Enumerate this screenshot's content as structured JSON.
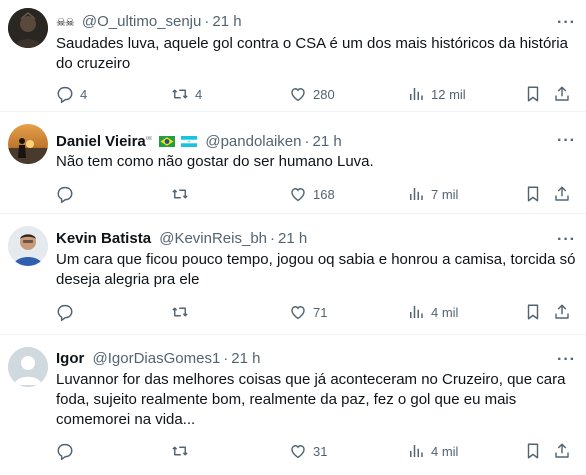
{
  "tweets": [
    {
      "name": "",
      "name_prefix": "☠☠",
      "handle": "@O_ultimo_senju",
      "time": "21 h",
      "text": "Saudades luva, aquele gol contra o CSA é um dos mais históricos da história do cruzeiro",
      "replies": "4",
      "retweets": "4",
      "likes": "280",
      "views": "12 mil"
    },
    {
      "name": "Daniel Vieira",
      "name_suffix": "ᶜᵉᶜ",
      "handle": "@pandolaiken",
      "time": "21 h",
      "text": "Não tem como não gostar do ser humano Luva.",
      "replies": "",
      "retweets": "",
      "likes": "168",
      "views": "7 mil"
    },
    {
      "name": "Kevin Batista",
      "handle": "@KevinReis_bh",
      "time": "21 h",
      "text": "Um cara que ficou pouco tempo, jogou oq sabia e honrou a camisa, torcida só deseja alegria pra ele",
      "replies": "",
      "retweets": "",
      "likes": "71",
      "views": "4 mil"
    },
    {
      "name": "Igor",
      "handle": "@IgorDiasGomes1",
      "time": "21 h",
      "text": "Luvannor for das melhores coisas que já aconteceram no Cruzeiro, que cara foda, sujeito realmente bom, realmente da paz, fez o gol que eu mais comemorei na vida...",
      "replies": "",
      "retweets": "",
      "likes": "31",
      "views": "4 mil"
    }
  ],
  "separator": "·",
  "more_glyph": "···",
  "colors": {
    "text": "#0f1419",
    "muted": "#536471",
    "divider": "#eff3f4"
  },
  "icons": [
    "reply-icon",
    "retweet-icon",
    "like-icon",
    "views-icon",
    "bookmark-icon",
    "share-icon",
    "more-icon",
    "brazil-flag-icon",
    "honduras-flag-icon"
  ]
}
